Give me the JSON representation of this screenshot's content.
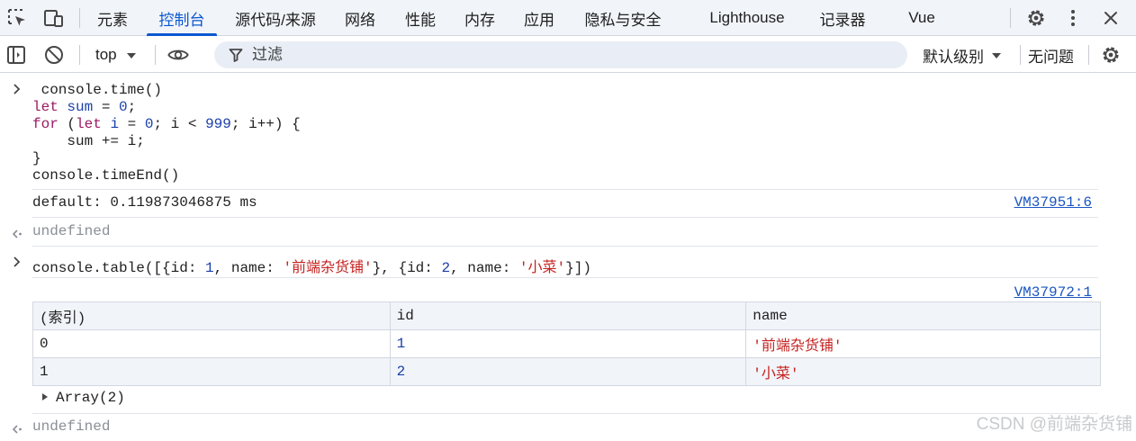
{
  "tabs": [
    {
      "label": "元素"
    },
    {
      "label": "控制台",
      "active": true
    },
    {
      "label": "源代码/来源"
    },
    {
      "label": "网络"
    },
    {
      "label": "性能"
    },
    {
      "label": "内存"
    },
    {
      "label": "应用"
    },
    {
      "label": "隐私与安全"
    },
    {
      "label": "Lighthouse"
    },
    {
      "label": "记录器"
    },
    {
      "label": "Vue"
    }
  ],
  "toolbar": {
    "context": "top",
    "filter_placeholder": "过滤",
    "log_level": "默认级别",
    "issues": "无问题"
  },
  "console": {
    "entry1": {
      "lines": [
        "console.time()",
        "let sum = 0;",
        "for (let i = 0; i < 999; i++) {",
        "    sum += i;",
        "}",
        "console.timeEnd()"
      ],
      "output": "default: 0.119873046875 ms",
      "source": "VM37951:6",
      "result": "undefined"
    },
    "entry2": {
      "input": "console.table([{id: 1, name: '前端杂货铺'}, {id: 2, name: '小菜'}])",
      "source": "VM37972:1",
      "table": {
        "headers": [
          "(索引)",
          "id",
          "name"
        ],
        "rows": [
          [
            "0",
            "1",
            "'前端杂货铺'"
          ],
          [
            "1",
            "2",
            "'小菜'"
          ]
        ]
      },
      "array_summary": "Array(2)",
      "result": "undefined"
    }
  },
  "watermark": "CSDN @前端杂货铺",
  "colors": {
    "accent": "#0b57d0",
    "keyword": "#9a1b63",
    "number": "#1a3fa8",
    "string": "#c5221f"
  }
}
